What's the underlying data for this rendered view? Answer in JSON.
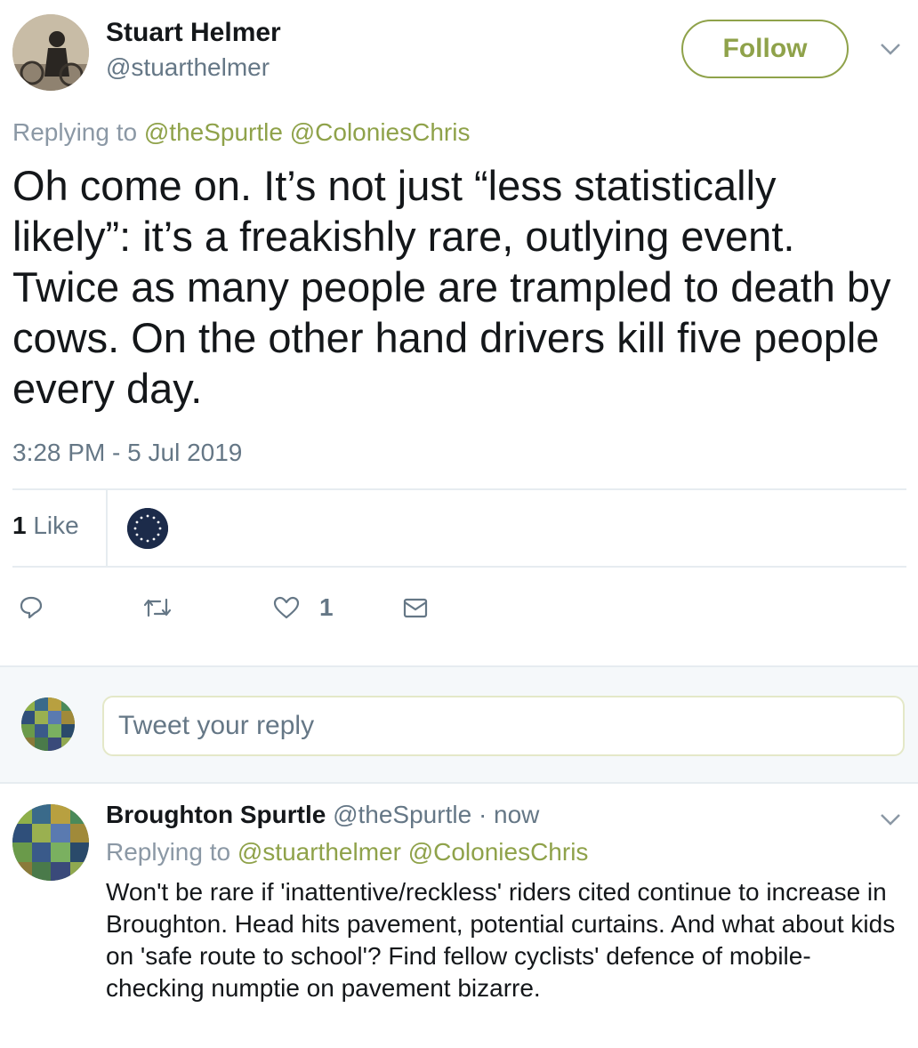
{
  "tweet": {
    "author_name": "Stuart Helmer",
    "author_handle": "@stuarthelmer",
    "follow_label": "Follow",
    "replying_prefix": "Replying to",
    "replying_mentions": [
      "@theSpurtle",
      "@ColoniesChris"
    ],
    "text": "Oh come on. It’s not just “less statistically likely”: it’s a freakishly rare, outlying event. Twice as many people are trampled to death by cows. On the other hand drivers kill five people every day.",
    "timestamp": "3:28 PM - 5 Jul 2019",
    "likes_count": "1",
    "likes_label": "Like",
    "action_like_count": "1"
  },
  "reply_box": {
    "placeholder": "Tweet your reply"
  },
  "reply": {
    "author_name": "Broughton Spurtle",
    "author_handle": "@theSpurtle",
    "time": "· now",
    "replying_prefix": "Replying to",
    "replying_mentions": [
      "@stuarthelmer",
      "@ColoniesChris"
    ],
    "text": "Won't be rare if 'inattentive/reckless' riders cited continue to increase in Broughton. Head hits pavement, potential curtains. And what about kids on 'safe route to school'? Find fellow cyclists' defence of mobile-checking numptie on pavement bizarre."
  },
  "icons": [
    "reply-icon",
    "retweet-icon",
    "heart-icon",
    "message-icon",
    "chevron-down-icon"
  ],
  "colors": {
    "accent": "#8fa24a",
    "muted": "#657786",
    "divider": "#e6ecf0"
  }
}
